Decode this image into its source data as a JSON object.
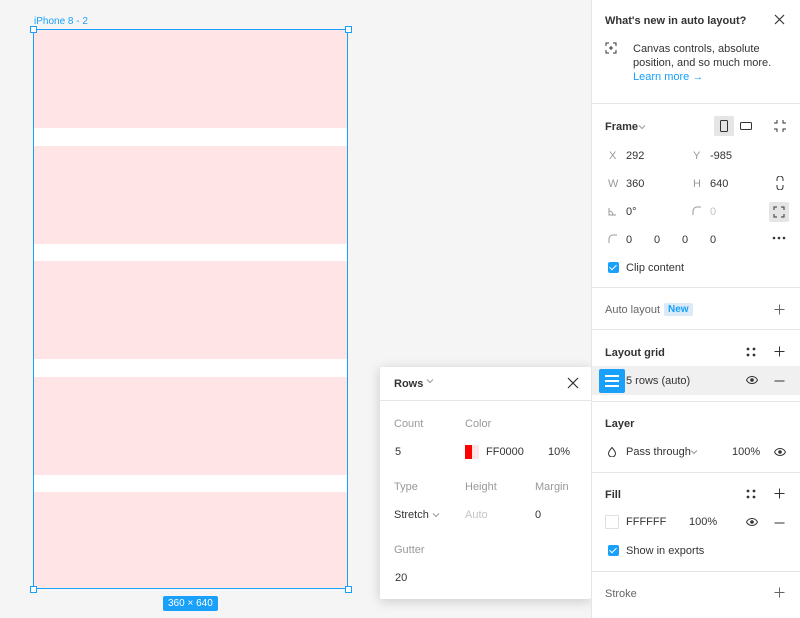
{
  "canvas": {
    "frame_name": "iPhone 8 - 2",
    "size_badge": "360 × 640"
  },
  "popup": {
    "title": "Rows",
    "count_label": "Count",
    "count_value": "5",
    "color_label": "Color",
    "color_hex": "FF0000",
    "color_opacity": "10%",
    "type_label": "Type",
    "type_value": "Stretch",
    "height_label": "Height",
    "height_placeholder": "Auto",
    "margin_label": "Margin",
    "margin_value": "0",
    "gutter_label": "Gutter",
    "gutter_value": "20"
  },
  "panel": {
    "whats_new": {
      "title": "What's new in auto layout?",
      "body_line1": "Canvas controls, absolute",
      "body_line2": "position, and so much more.",
      "link": "Learn more →"
    },
    "frame": {
      "title": "Frame",
      "x_label": "X",
      "x_value": "292",
      "y_label": "Y",
      "y_value": "-985",
      "w_label": "W",
      "w_value": "360",
      "h_label": "H",
      "h_value": "640",
      "rotation_value": "0°",
      "corner_radius_value": "0",
      "corners": [
        "0",
        "0",
        "0",
        "0"
      ],
      "clip_content_label": "Clip content"
    },
    "auto_layout": {
      "title": "Auto layout",
      "badge": "New"
    },
    "layout_grid": {
      "title": "Layout grid",
      "item_label": "5 rows (auto)"
    },
    "layer": {
      "title": "Layer",
      "blend_mode": "Pass through",
      "opacity": "100%"
    },
    "fill": {
      "title": "Fill",
      "hex": "FFFFFF",
      "opacity": "100%",
      "show_in_exports_label": "Show in exports"
    },
    "stroke": {
      "title": "Stroke"
    }
  },
  "colors": {
    "accent": "#18a0fb",
    "grid_color": "#ff0000"
  }
}
